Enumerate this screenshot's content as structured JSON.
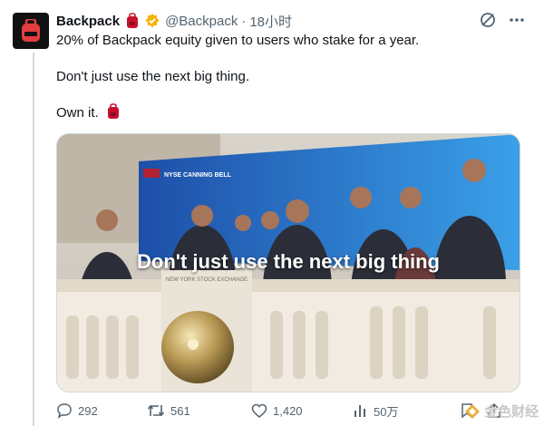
{
  "tweet": {
    "author_name": "Backpack",
    "handle": "@Backpack",
    "separator": "·",
    "time": "18小时",
    "lines": [
      "20% of Backpack equity given to users who stake for a year.",
      "Don't just use the next big thing.",
      "Own it."
    ]
  },
  "media": {
    "caption": "Don't just use the next big thing",
    "sign_text": "NYSE CANNING BELL",
    "podium_text": "NEW YORK STOCK EXCHANGE"
  },
  "actions": {
    "replies": "292",
    "reposts": "561",
    "likes": "1,420",
    "views": "50万"
  },
  "watermark": {
    "text": "金色财经"
  },
  "colors": {
    "brand_red": "#e33e3f",
    "verified_gold": "#f4b400",
    "muted": "#536471",
    "rule": "#cfd9de"
  },
  "icons": [
    "backpack-logo-icon",
    "backpack-emoji-icon",
    "verified-badge-icon",
    "grok-icon",
    "more-icon",
    "reply-icon",
    "repost-icon",
    "like-icon",
    "views-icon",
    "bookmark-icon",
    "share-icon"
  ]
}
